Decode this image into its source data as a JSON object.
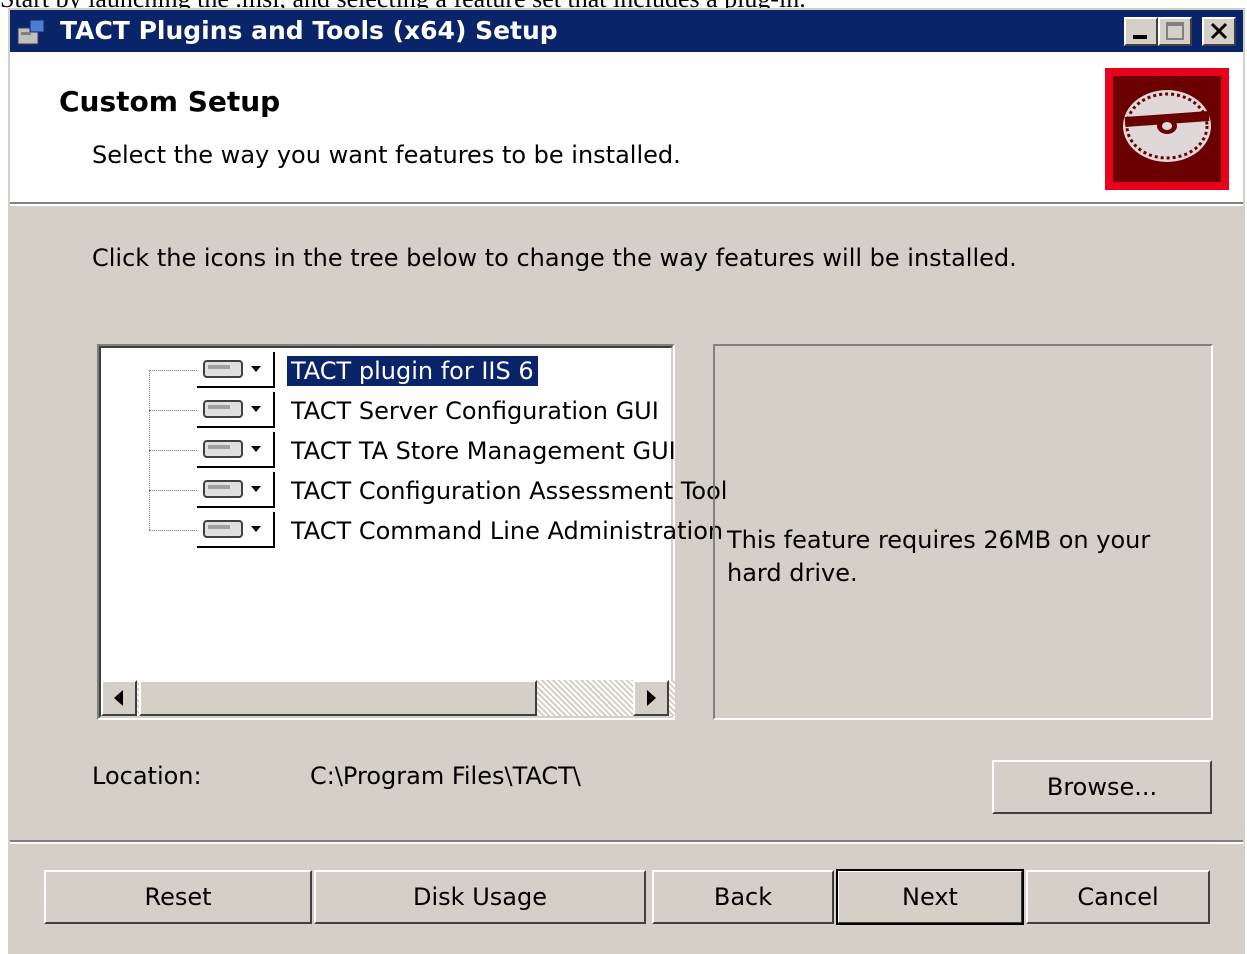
{
  "caption_partial": "Start by launching the .msi, and selecting a feature set that includes a plug-in.",
  "window": {
    "title": "TACT Plugins and Tools (x64) Setup"
  },
  "header": {
    "title": "Custom Setup",
    "subtitle": "Select the way you want features to be installed."
  },
  "instructions": "Click the icons in the tree below to change the way features will be installed.",
  "tree": {
    "items": [
      {
        "label": "TACT plugin for IIS 6",
        "selected": true
      },
      {
        "label": "TACT Server Configuration GUI",
        "selected": false
      },
      {
        "label": "TACT TA Store Management GUI",
        "selected": false
      },
      {
        "label": "TACT Configuration Assessment Tool",
        "selected": false
      },
      {
        "label": "TACT Command Line Administration",
        "selected": false
      }
    ]
  },
  "description": "This feature requires 26MB on your hard drive.",
  "location": {
    "label": "Location:",
    "value": "C:\\Program Files\\TACT\\"
  },
  "buttons": {
    "browse": "Browse...",
    "reset": "Reset",
    "disk_usage": "Disk Usage",
    "back": "Back",
    "next": "Next",
    "cancel": "Cancel"
  },
  "colors": {
    "titlebar": "#0a246a",
    "dialog_face": "#d4d0c8",
    "banner_red": "#e8001c",
    "banner_dark": "#6b0000"
  }
}
